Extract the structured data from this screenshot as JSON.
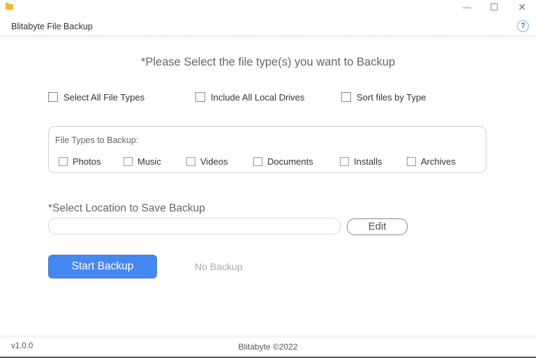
{
  "window": {
    "title": "Blitabyte File Backup",
    "app_icon": "folder-icon",
    "controls": {
      "minimize": "—",
      "maximize": "□",
      "close": "✕"
    },
    "help_icon_glyph": "?"
  },
  "main": {
    "heading": "*Please Select the file type(s) you want to Backup",
    "options": [
      {
        "label": "Select All File Types",
        "checked": false
      },
      {
        "label": "Include All Local Drives",
        "checked": false
      },
      {
        "label": "Sort files by Type",
        "checked": false
      }
    ],
    "file_types": {
      "title": "File Types to Backup:",
      "items": [
        {
          "label": "Photos",
          "checked": false
        },
        {
          "label": "Music",
          "checked": false
        },
        {
          "label": "Videos",
          "checked": false
        },
        {
          "label": "Documents",
          "checked": false
        },
        {
          "label": "Installs",
          "checked": false
        },
        {
          "label": "Archives",
          "checked": false
        }
      ]
    },
    "location": {
      "label": "*Select Location to Save Backup",
      "value": "",
      "placeholder": "",
      "edit_label": "Edit"
    },
    "start_label": "Start Backup",
    "status": "No Backup",
    "accent_color": "#4688f1"
  },
  "footer": {
    "version": "v1.0.0",
    "copyright": "Blitabyte ©2022"
  }
}
